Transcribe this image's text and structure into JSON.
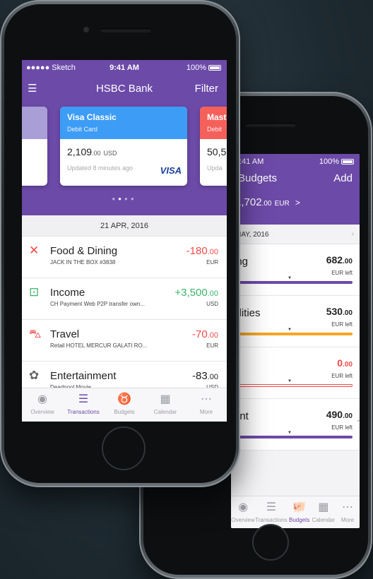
{
  "back_phone": {
    "status": {
      "time": "9:41 AM",
      "battery": "100%"
    },
    "nav": {
      "title": "Budgets",
      "action": "Add"
    },
    "total": {
      "amount": "1,702",
      "decimals": ".00",
      "currency": "EUR",
      "arrow": ">"
    },
    "month_header": "MAY, 2016",
    "budgets": [
      {
        "name": "ing",
        "sub": "",
        "amount": "682",
        "decimals": ".00",
        "left_label": "EUR left",
        "status": "neutral",
        "bar_color": "#6c4aa8",
        "marker": 0.5
      },
      {
        "name": "tilities",
        "sub": "nt",
        "amount": "530",
        "decimals": ".00",
        "left_label": "EUR left",
        "status": "neutral",
        "bar_color": "#f5a623",
        "marker": 0.5
      },
      {
        "name": "",
        "sub": "t",
        "amount": "0",
        "decimals": ".00",
        "left_label": "EUR left",
        "status": "negative",
        "bar_color": "#f14a4a",
        "marker": 0.5
      },
      {
        "name": "ent",
        "sub": "",
        "amount": "490",
        "decimals": ".00",
        "left_label": "EUR left",
        "status": "neutral",
        "bar_color": "#6c4aa8",
        "marker": 0.5
      }
    ],
    "tabs": [
      {
        "label": "Overview",
        "icon": "eye-icon",
        "glyph": "◉"
      },
      {
        "label": "Transactions",
        "icon": "list-icon",
        "glyph": "☰"
      },
      {
        "label": "Budgets",
        "icon": "piggy-bank-icon",
        "glyph": "🐖"
      },
      {
        "label": "Calendar",
        "icon": "calendar-icon",
        "glyph": "▦"
      },
      {
        "label": "More",
        "icon": "more-icon",
        "glyph": "⋯"
      }
    ]
  },
  "front_phone": {
    "status": {
      "carrier": "●●●●● Sketch",
      "time": "9:41 AM",
      "battery": "100%"
    },
    "nav": {
      "title": "HSBC Bank",
      "filter": "Filter"
    },
    "cards": [
      {
        "title": "Visa Classic",
        "subtitle": "Debit Card",
        "amount": "2,109",
        "decimals": ".00",
        "currency": "USD",
        "updated": "Updated 8 minutes ago",
        "brand": "VISA",
        "color": "#3d9cf5"
      },
      {
        "title": "Mast",
        "subtitle": "Debit",
        "amount": "50,5",
        "decimals": "",
        "currency": "",
        "updated": "Upda",
        "brand": "",
        "color": "#f5605b"
      }
    ],
    "date_header": "21 APR, 2016",
    "transactions": [
      {
        "category": "Food & Dining",
        "description": "JACK IN THE BOX #3838",
        "amount": "-180",
        "decimals": ".00",
        "currency": "EUR",
        "sign": "neg",
        "icon": "utensils-icon",
        "glyph": "✕",
        "icon_color": "#f14a4a"
      },
      {
        "category": "Income",
        "description": "CH Payment Web P2P transfer own...",
        "amount": "+3,500",
        "decimals": ".00",
        "currency": "USD",
        "sign": "pos",
        "icon": "inbox-download-icon",
        "glyph": "⊡",
        "icon_color": "#3bb36b"
      },
      {
        "category": "Travel",
        "description": "Retail HOTEL MERCUR GALATI RO...",
        "amount": "-70",
        "decimals": ".00",
        "currency": "EUR",
        "sign": "neg",
        "icon": "car-icon",
        "glyph": "⛍",
        "icon_color": "#f14a4a"
      },
      {
        "category": "Entertainment",
        "description": "Deadpool Movie",
        "amount": "-83",
        "decimals": ".00",
        "currency": "USD",
        "sign": "neu",
        "icon": "badge-icon",
        "glyph": "✿",
        "icon_color": "#666666"
      }
    ],
    "tabs": [
      {
        "label": "Overview",
        "icon": "eye-icon",
        "glyph": "◉"
      },
      {
        "label": "Transactions",
        "icon": "list-icon",
        "glyph": "☰"
      },
      {
        "label": "Budgets",
        "icon": "piggy-bank-icon",
        "glyph": "♉"
      },
      {
        "label": "Calendar",
        "icon": "calendar-icon",
        "glyph": "▦"
      },
      {
        "label": "More",
        "icon": "more-icon",
        "glyph": "⋯"
      }
    ],
    "active_tab": 1
  },
  "colors": {
    "brand_purple": "#6c4aa8",
    "negative": "#f14a4a",
    "positive": "#3bb36b"
  }
}
